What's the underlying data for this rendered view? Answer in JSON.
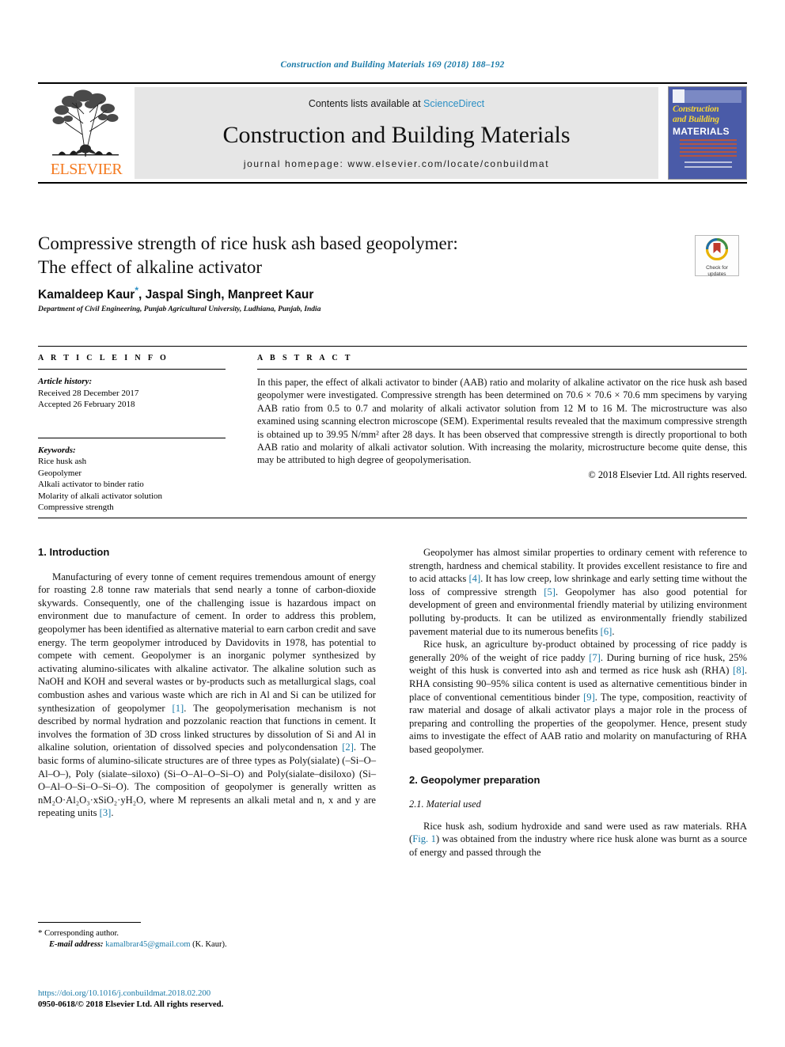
{
  "running_head": "Construction and Building Materials 169 (2018) 188–192",
  "masthead": {
    "publisher_name": "ELSEVIER",
    "contents_prefix": "Contents lists available at",
    "contents_link": "ScienceDirect",
    "journal_name": "Construction and Building Materials",
    "homepage": "journal homepage: www.elsevier.com/locate/conbuildmat",
    "cover": {
      "line1": "Construction",
      "line2": "and Building",
      "line3": "MATERIALS"
    }
  },
  "article": {
    "title_line1": "Compressive strength of rice husk ash based geopolymer:",
    "title_line2": "The effect of alkaline activator",
    "authors": "Kamaldeep Kaur",
    "authors_rest": ", Jaspal Singh, Manpreet Kaur",
    "corresponding_marker": "*",
    "affiliation": "Department of Civil Engineering, Punjab Agricultural University, Ludhiana, Punjab, India",
    "crossmark_label_line1": "Check for",
    "crossmark_label_line2": "updates"
  },
  "article_info": {
    "section_label": "A R T I C L E   I N F O",
    "history_heading": "Article history:",
    "received": "Received 28 December 2017",
    "accepted": "Accepted 26 February 2018",
    "keywords_heading": "Keywords:",
    "keywords": [
      "Rice husk ash",
      "Geopolymer",
      "Alkali activator to binder ratio",
      "Molarity of alkali activator solution",
      "Compressive strength"
    ]
  },
  "abstract": {
    "section_label": "A B S T R A C T",
    "text": "In this paper, the effect of alkali activator to binder (AAB) ratio and molarity of alkaline activator on the rice husk ash based geopolymer were investigated. Compressive strength has been determined on 70.6 × 70.6 × 70.6 mm specimens by varying AAB ratio from 0.5 to 0.7 and molarity of alkali activator solution from 12 M to 16 M. The microstructure was also examined using scanning electron microscope (SEM). Experimental results revealed that the maximum compressive strength is obtained up to 39.95 N/mm² after 28 days. It has been observed that compressive strength is directly proportional to both AAB ratio and molarity of alkali activator solution. With increasing the molarity, microstructure become quite dense, this may be attributed to high degree of geopolymerisation.",
    "copyright": "© 2018 Elsevier Ltd. All rights reserved."
  },
  "body": {
    "left": {
      "heading": "1. Introduction",
      "para1_a": "Manufacturing of every tonne of cement requires tremendous amount of energy for roasting 2.8 tonne raw materials that send nearly a tonne of carbon-dioxide skywards. Consequently, one of the challenging issue is hazardous impact on environment due to manufacture of cement. In order to address this problem, geopolymer has been identified as alternative material to earn carbon credit and save energy. The term geopolymer introduced by Davidovits in 1978, has potential to compete with cement. Geopolymer is an inorganic polymer synthesized by activating alumino-silicates with alkaline activator. The alkaline solution such as NaOH and KOH and several wastes or by-products such as metallurgical slags, coal combustion ashes and various waste which are rich in Al and Si can be utilized for synthesization of geopolymer ",
      "ref1": "[1]",
      "para1_b": ". The geopolymerisation mechanism is not described by normal hydration and pozzolanic reaction that functions in cement. It involves the formation of 3D cross linked structures by dissolution of Si and Al in alkaline solution, orientation of dissolved species and polycondensation ",
      "ref2": "[2]",
      "para1_c": ". The basic forms of alumino-silicate structures are of three types as Poly(sialate) (–Si–O–Al–O–), Poly (sialate–siloxo) (Si–O–Al–O–Si–O) and Poly(sialate–disiloxo) (Si–O–Al–O–Si–O–Si–O). The composition of geopolymer is generally written as nM₂O·Al₂O₃·xSiO₂·yH₂O, where M represents an alkali metal and n, x and y are repeating units ",
      "ref3": "[3]",
      "para1_d": "."
    },
    "right": {
      "para1_a": "Geopolymer has almost similar properties to ordinary cement with reference to strength, hardness and chemical stability. It provides excellent resistance to fire and to acid attacks ",
      "ref4": "[4]",
      "para1_b": ". It has low creep, low shrinkage and early setting time without the loss of compressive strength ",
      "ref5": "[5]",
      "para1_c": ". Geopolymer has also good potential for development of green and environmental friendly material by utilizing environment polluting by-products. It can be utilized as environmentally friendly stabilized pavement material due to its numerous benefits ",
      "ref6": "[6]",
      "para1_d": ".",
      "para2_a": "Rice husk, an agriculture by-product obtained by processing of rice paddy is generally 20% of the weight of rice paddy ",
      "ref7": "[7]",
      "para2_b": ". During burning of rice husk, 25% weight of this husk is converted into ash and termed as rice husk ash (RHA) ",
      "ref8": "[8]",
      "para2_c": ". RHA consisting 90–95% silica content is used as alternative cementitious binder in place of conventional cementitious binder ",
      "ref9": "[9]",
      "para2_d": ". The type, composition, reactivity of raw material and dosage of alkali activator plays a major role in the process of preparing and controlling the properties of the geopolymer. Hence, present study aims to investigate the effect of AAB ratio and molarity on manufacturing of RHA based geopolymer.",
      "heading2": "2. Geopolymer preparation",
      "subheading21": "2.1. Material used",
      "para3_a": "Rice husk ash, sodium hydroxide and sand were used as raw materials. RHA (",
      "fig_link": "Fig. 1",
      "para3_b": ") was obtained from the industry where rice husk alone was burnt as a source of energy and passed through the"
    }
  },
  "footnote": {
    "corresponding_star": "*",
    "corresponding_text": "Corresponding author.",
    "email_label": "E-mail address:",
    "email": "kamalbrar45@gmail.com",
    "email_suffix": "(K. Kaur)."
  },
  "doi_block": {
    "doi": "https://doi.org/10.1016/j.conbuildmat.2018.02.200",
    "issn_copyright": "0950-0618/© 2018 Elsevier Ltd. All rights reserved."
  }
}
